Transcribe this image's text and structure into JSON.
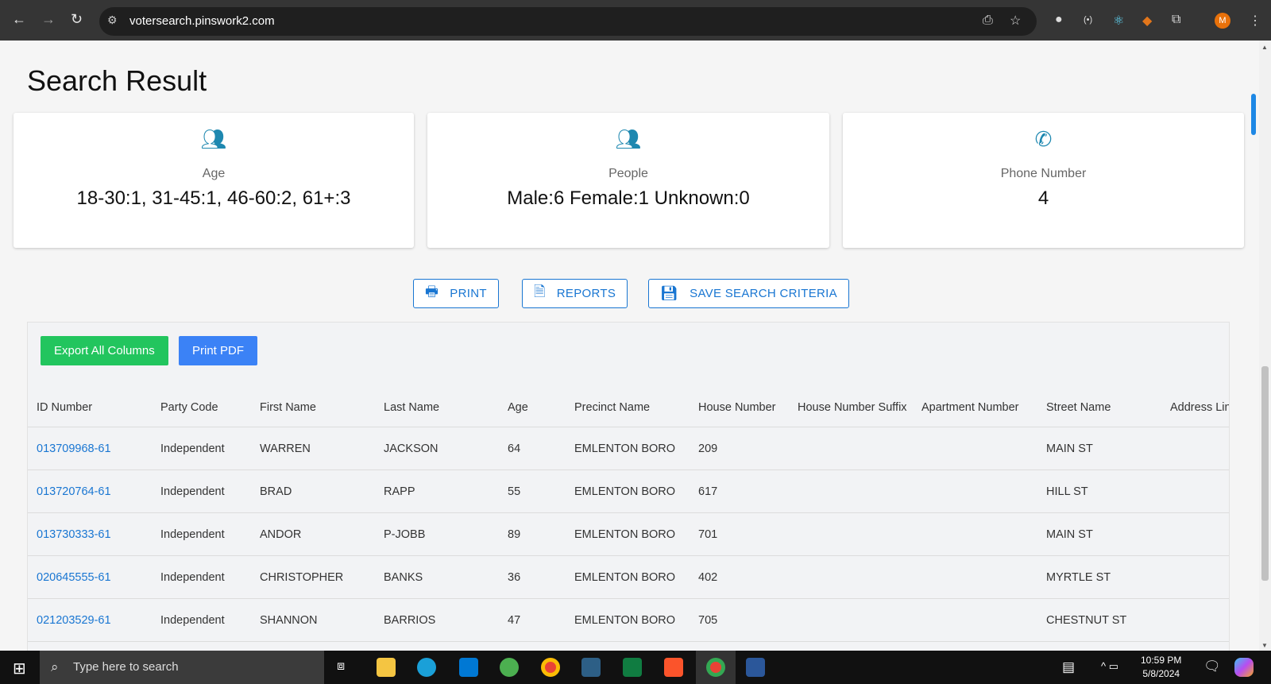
{
  "browser": {
    "url": "votersearch.pinswork2.com",
    "avatar_letter": "M"
  },
  "page": {
    "title": "Search Result"
  },
  "cards": [
    {
      "icon": "users-icon",
      "label": "Age",
      "value": "18-30:1, 31-45:1, 46-60:2, 61+:3"
    },
    {
      "icon": "users-icon",
      "label": "People",
      "value": "Male:6 Female:1 Unknown:0"
    },
    {
      "icon": "phone-icon",
      "label": "Phone Number",
      "value": "4"
    }
  ],
  "actions": {
    "print": "PRINT",
    "reports": "REPORTS",
    "save": "SAVE SEARCH CRITERIA"
  },
  "table_actions": {
    "export": "Export All Columns",
    "print_pdf": "Print PDF"
  },
  "colors": {
    "accent": "#1976d2",
    "export_green": "#22c55e",
    "print_pdf_blue": "#3b82f6",
    "icon_teal": "#1e88b0"
  },
  "table": {
    "columns": [
      "ID Number",
      "Party Code",
      "First Name",
      "Last Name",
      "Age",
      "Precinct Name",
      "House Number",
      "House Number Suffix",
      "Apartment Number",
      "Street Name",
      "Address Lin"
    ],
    "rows": [
      [
        "013709968-61",
        "Independent",
        "WARREN",
        "JACKSON",
        "64",
        "EMLENTON BORO",
        "209",
        "",
        "",
        "MAIN ST",
        ""
      ],
      [
        "013720764-61",
        "Independent",
        "BRAD",
        "RAPP",
        "55",
        "EMLENTON BORO",
        "617",
        "",
        "",
        "HILL ST",
        ""
      ],
      [
        "013730333-61",
        "Independent",
        "ANDOR",
        "P-JOBB",
        "89",
        "EMLENTON BORO",
        "701",
        "",
        "",
        "MAIN ST",
        ""
      ],
      [
        "020645555-61",
        "Independent",
        "CHRISTOPHER",
        "BANKS",
        "36",
        "EMLENTON BORO",
        "402",
        "",
        "",
        "MYRTLE ST",
        ""
      ],
      [
        "021203529-61",
        "Independent",
        "SHANNON",
        "BARRIOS",
        "47",
        "EMLENTON BORO",
        "705",
        "",
        "",
        "CHESTNUT ST",
        ""
      ]
    ]
  },
  "taskbar": {
    "search_placeholder": "Type here to search",
    "time": "10:59 PM",
    "date": "5/8/2024"
  }
}
